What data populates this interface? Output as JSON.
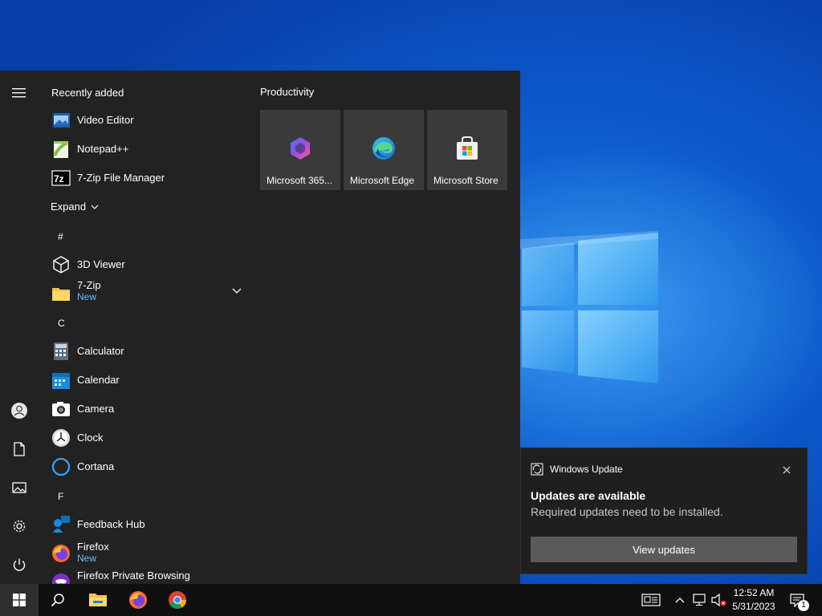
{
  "start_menu": {
    "recently_added_header": "Recently added",
    "recent_apps": [
      {
        "label": "Video Editor",
        "icon": "video-editor-icon"
      },
      {
        "label": "Notepad++",
        "icon": "notepad-plus-plus-icon"
      },
      {
        "label": "7-Zip File Manager",
        "icon": "7zip-icon"
      }
    ],
    "expand_label": "Expand",
    "sections": {
      "hash": "#",
      "c": "C",
      "f": "F"
    },
    "apps": {
      "viewer3d": {
        "label": "3D Viewer"
      },
      "sevenzip": {
        "label": "7-Zip",
        "sub": "New"
      },
      "calculator": {
        "label": "Calculator"
      },
      "calendar": {
        "label": "Calendar"
      },
      "camera": {
        "label": "Camera"
      },
      "clock": {
        "label": "Clock"
      },
      "cortana": {
        "label": "Cortana"
      },
      "feedback": {
        "label": "Feedback Hub"
      },
      "firefox": {
        "label": "Firefox",
        "sub": "New"
      },
      "firefox_private": {
        "label": "Firefox Private Browsing"
      }
    },
    "tile_group": "Productivity",
    "tiles": [
      {
        "label": "Microsoft 365...",
        "icon": "microsoft-365-icon"
      },
      {
        "label": "Microsoft Edge",
        "icon": "edge-icon"
      },
      {
        "label": "Microsoft Store",
        "icon": "store-icon"
      }
    ]
  },
  "toast": {
    "app_name": "Windows Update",
    "title": "Updates are available",
    "body": "Required updates need to be installed.",
    "button": "View updates"
  },
  "taskbar": {
    "time": "12:52 AM",
    "date": "5/31/2023",
    "notification_count": "1"
  },
  "colors": {
    "menu_bg": "#222222",
    "tile_bg": "#3a3a3a",
    "accent_new": "#6cb8ff",
    "taskbar_bg": "#101010"
  }
}
